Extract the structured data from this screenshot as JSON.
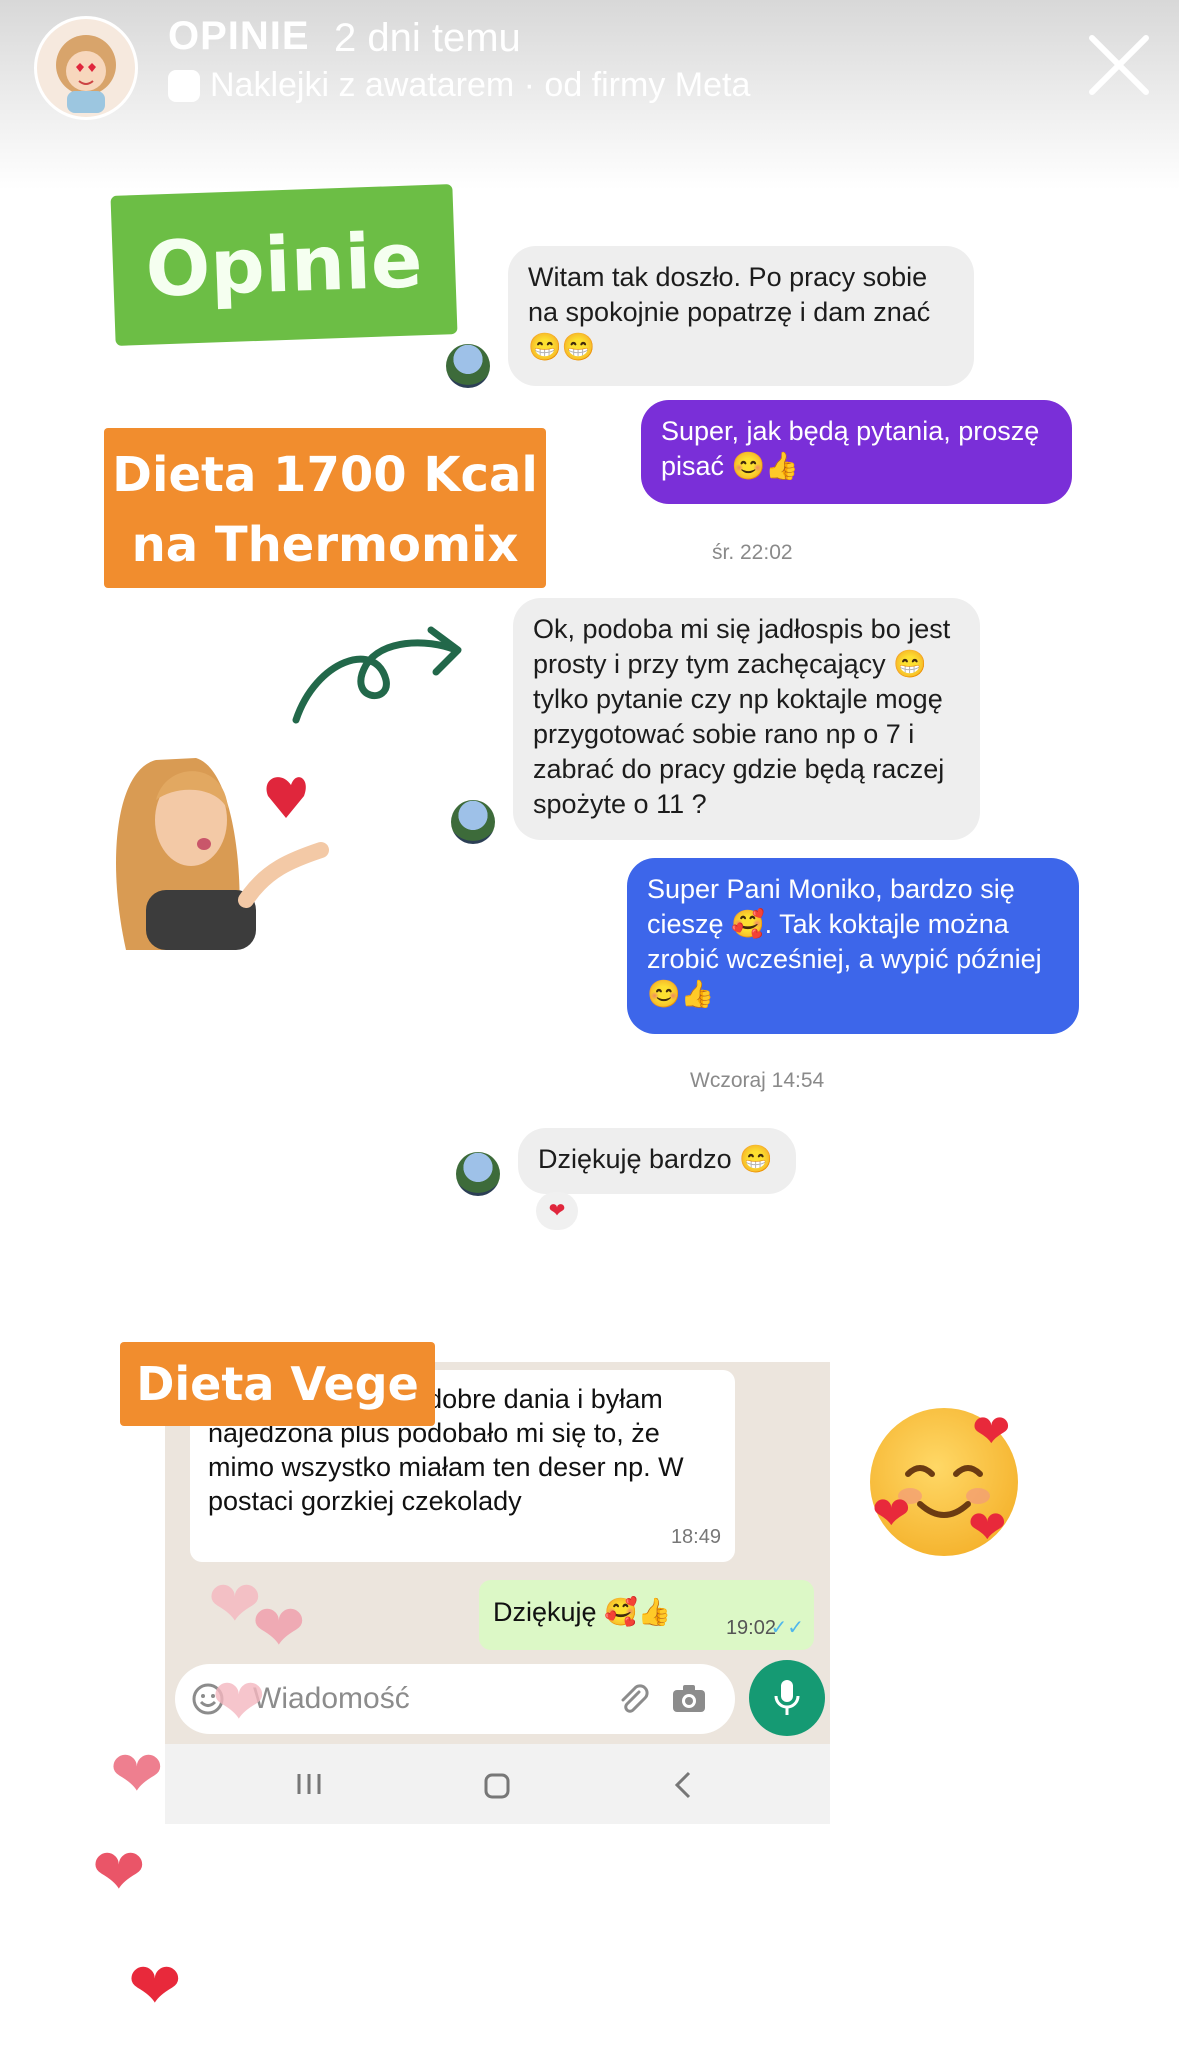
{
  "story": {
    "title": "OPINIE",
    "time": "2 dni temu",
    "subtitle": "Naklejki z awatarem · od firmy Meta"
  },
  "labels": {
    "opinie": "Opinie",
    "dieta_line1": "Dieta 1700 Kcal",
    "dieta_line2": "na Thermomix",
    "vege": "Dieta Vege"
  },
  "messenger": {
    "msg1": "Witam tak doszło. Po pracy sobie na spokojnie popatrzę i dam znać 😁😁",
    "msg2": "Super, jak będą pytania, proszę pisać 😊👍",
    "ts1": "śr. 22:02",
    "msg3": "Ok, podoba mi się jadłospis bo jest prosty i przy tym zachęcający 😁 tylko pytanie czy np koktajle mogę przygotować sobie rano np o 7 i zabrać do pracy gdzie będą raczej spożyte o 11 ?",
    "msg4": "Super Pani Moniko, bardzo się cieszę 🥰. Tak koktajle można zrobić wcześniej, a wypić później 😊👍",
    "ts2": "Wczoraj 14:54",
    "msg5": "Dziękuję bardzo 😁",
    "reaction": "❤"
  },
  "whatsapp": {
    "msg_in": "to były na prawdę dobre dania i byłam najedzona plus podobało mi się to, że mimo wszystko miałam ten deser np. W postaci gorzkiej czekolady",
    "msg_in_time": "18:49",
    "msg_out": "Dziękuję 🥰👍",
    "msg_out_time": "19:02",
    "ticks": "✓✓",
    "input_placeholder": "Wiadomość"
  },
  "colors": {
    "green_label": "#6cbe45",
    "orange_label": "#f18d2e",
    "purple_bubble": "#7a2fd8",
    "blue_bubble": "#3d66ea",
    "heart_pink": "#ee7f8f",
    "heart_red": "#e8293b"
  }
}
